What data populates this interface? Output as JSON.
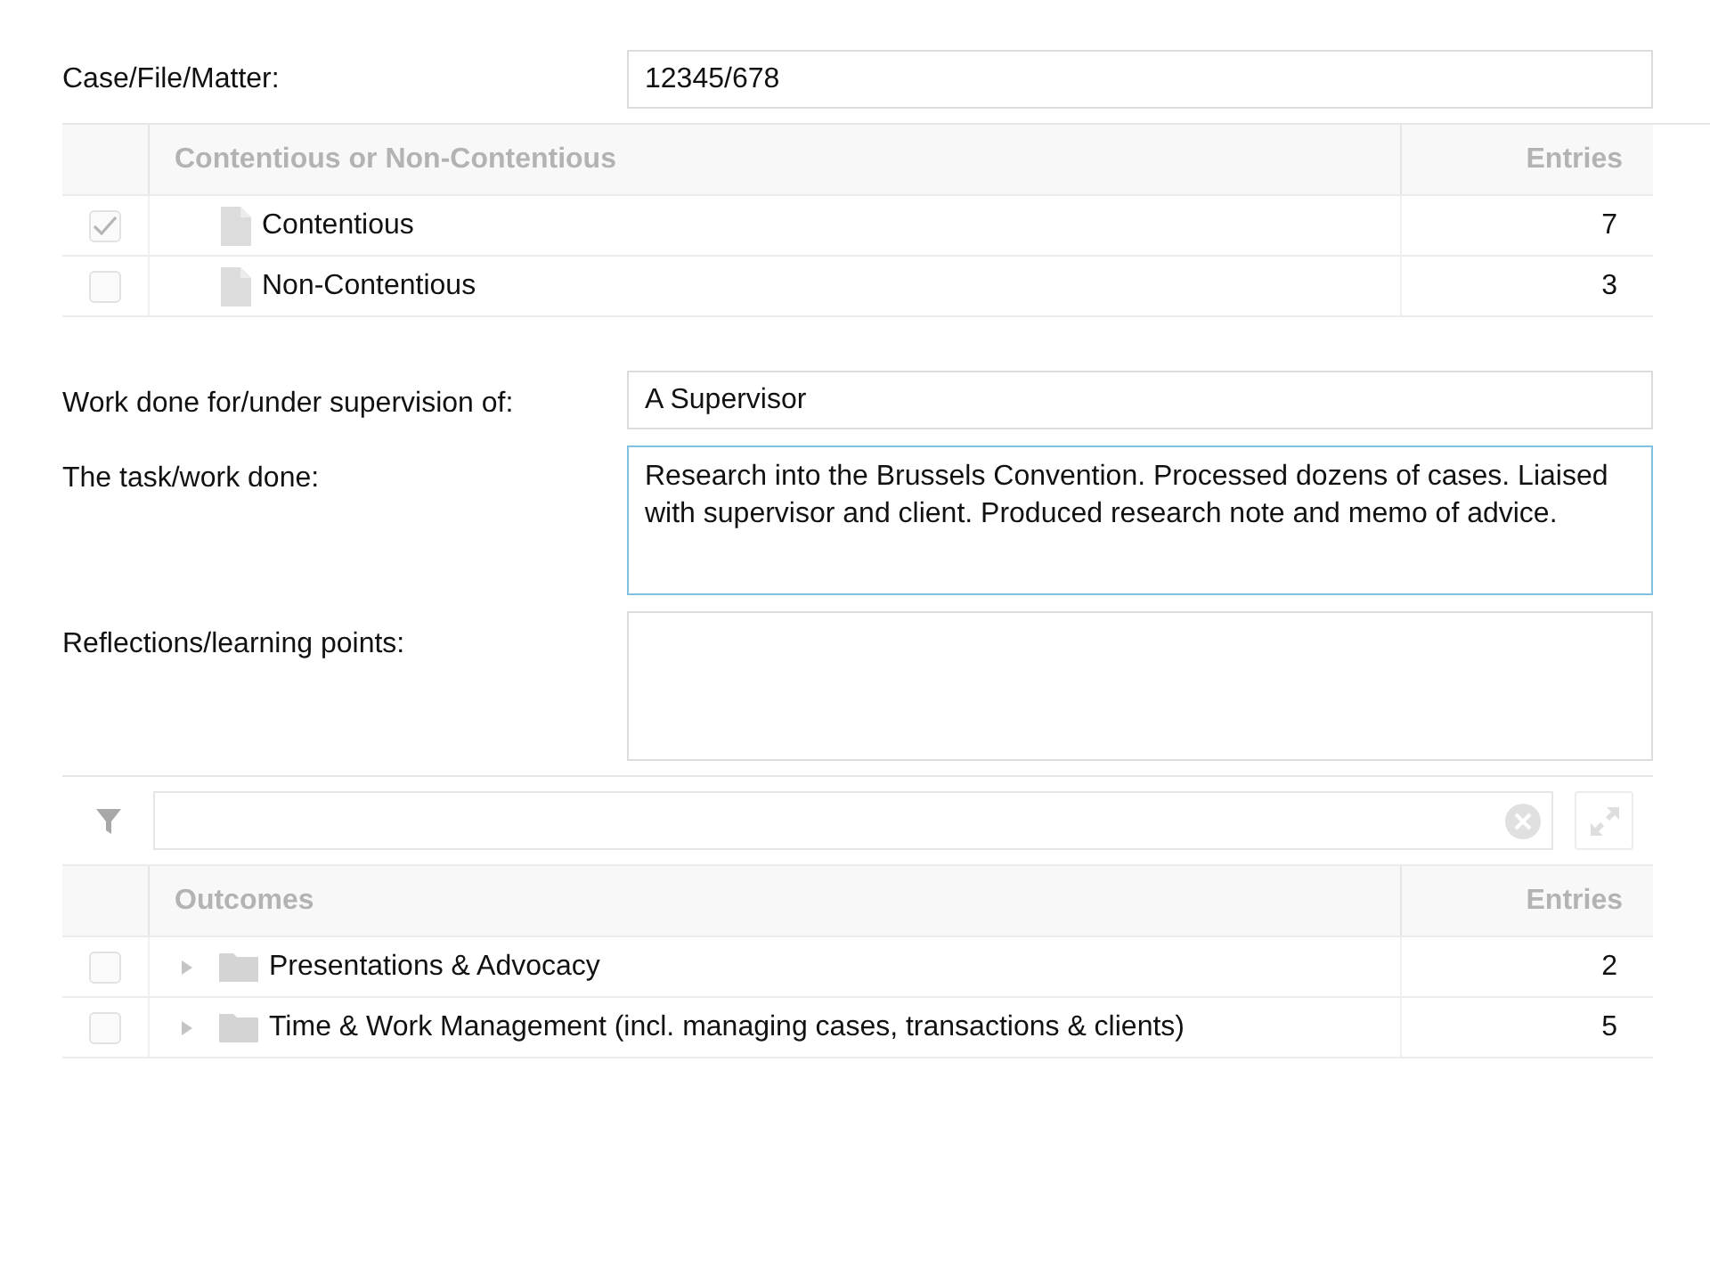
{
  "case_field": {
    "label": "Case/File/Matter:",
    "value": "12345/678",
    "focused": false
  },
  "type_table": {
    "columns": [
      "Contentious or Non-Contentious",
      "Entries"
    ],
    "rows": [
      {
        "name": "Contentious",
        "entries": "7",
        "checked": true,
        "kind": "file"
      },
      {
        "name": "Non-Contentious",
        "entries": "3",
        "checked": false,
        "kind": "file"
      }
    ]
  },
  "fields": [
    {
      "label": "Work done for/under supervision of:",
      "value": "A Supervisor",
      "kind": "input",
      "focused": false
    },
    {
      "label": "The task/work done:",
      "value": "Research into the Brussels Convention. Processed dozens of cases. Liaised with supervisor and client. Produced research note and memo of advice.",
      "kind": "textarea",
      "focused": true
    },
    {
      "label": "Reflections/learning points:",
      "kind": "textarea",
      "focused": false
    }
  ],
  "outcomes_table": {
    "columns": [
      "Outcomes",
      "Entries"
    ],
    "rows": [
      {
        "name": "Presentations & Advocacy",
        "entries": "2",
        "checked": false,
        "kind": "folder"
      },
      {
        "name": "Time & Work Management (incl. managing cases, transactions & clients)",
        "entries": "5",
        "checked": false,
        "kind": "folder"
      }
    ]
  }
}
